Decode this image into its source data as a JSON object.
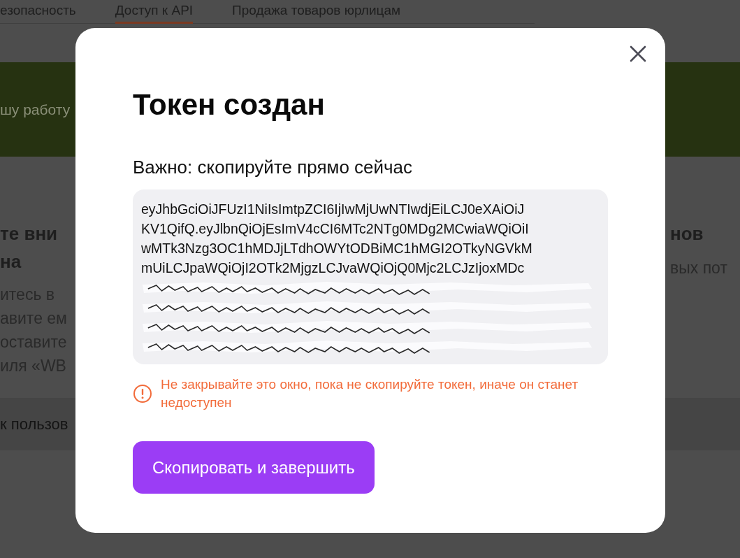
{
  "background_page": {
    "tabs": [
      {
        "label": "езопасность",
        "selected": false
      },
      {
        "label": "Доступ к API",
        "selected": true
      },
      {
        "label": "Продажа товаров юрлицам",
        "selected": false
      }
    ],
    "banner": {
      "text": "шу работу"
    },
    "left_heading": [
      "те вни",
      "на"
    ],
    "left_paragraph": [
      "итесь в",
      "авите ем",
      "оставите",
      "иля «WB"
    ],
    "right_heading": "нов",
    "right_paragraph": "вых пот",
    "bottom_link": "к пользов"
  },
  "dialog": {
    "title": "Токен создан",
    "subtitle": "Важно: скопируйте прямо сейчас",
    "token_lines": [
      "eyJhbGciOiJFUzI1NiIsImtpZCI6IjIwMjUwNTIwdjEiLCJ0eXAiOiJ",
      "KV1QifQ.eyJlbnQiOjEsImV4cCI6MTc2NTg0MDg2MCwiaWQiOiI",
      "wMTk3Nzg3OC1hMDJjLTdhOWYtODBiMC1hMGI2OTkyNGVkM",
      "mUiLCJpaWQiOjI2OTk2MjgzLCJvaWQiOjQ0Mjc2LCJzIjoxMDc"
    ],
    "warning": "Не закрывайте это окно, пока не скопируйте токен, иначе он станет недоступен",
    "button": "Скопировать и завершить"
  }
}
